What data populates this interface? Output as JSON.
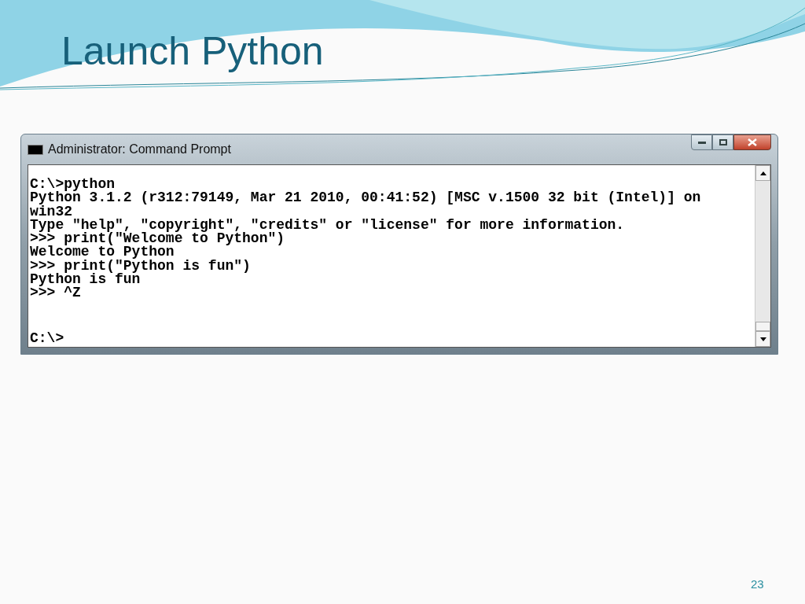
{
  "slide": {
    "title": "Launch Python",
    "page_number": "23"
  },
  "console_window": {
    "title": "Administrator: Command Prompt",
    "lines": [
      "C:\\>python",
      "Python 3.1.2 (r312:79149, Mar 21 2010, 00:41:52) [MSC v.1500 32 bit (Intel)] on",
      "win32",
      "Type \"help\", \"copyright\", \"credits\" or \"license\" for more information.",
      ">>> print(\"Welcome to Python\")",
      "Welcome to Python",
      ">>> print(\"Python is fun\")",
      "Python is fun",
      ">>> ^Z"
    ],
    "prompt": "C:\\>"
  }
}
